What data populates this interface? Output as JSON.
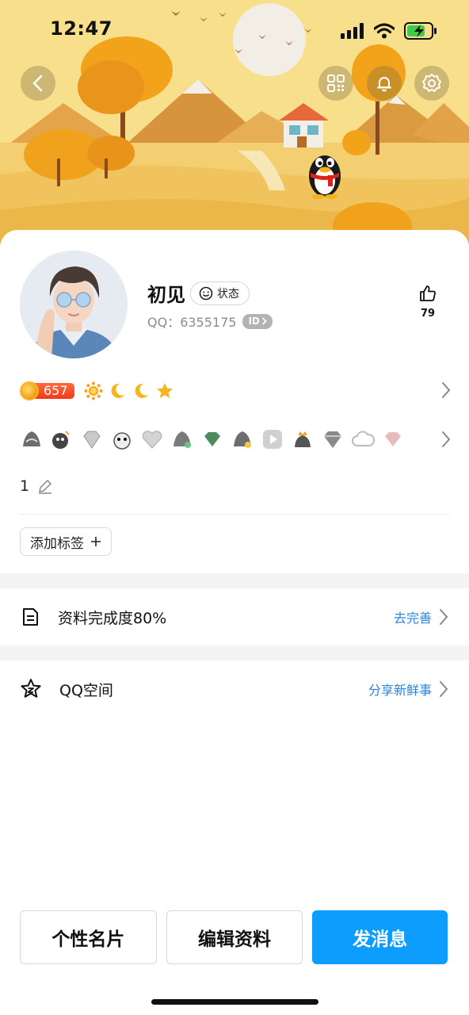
{
  "status_bar": {
    "time": "12:47"
  },
  "profile": {
    "name": "初见",
    "status_label": "状态",
    "qq_label": "QQ：6355175",
    "id_badge": "ID",
    "likes": "79",
    "sun_level": "657",
    "signature": "1"
  },
  "tags": {
    "add_label": "添加标签"
  },
  "rows": {
    "completion": {
      "label": "资料完成度80%",
      "action": "去完善"
    },
    "qzone": {
      "label": "QQ空间",
      "action": "分享新鲜事"
    }
  },
  "buttons": {
    "card": "个性名片",
    "edit": "编辑资料",
    "message": "发消息"
  },
  "colors": {
    "primary": "#0d9dfc",
    "link": "#2c84d6",
    "level_badge": "#f2391a"
  }
}
